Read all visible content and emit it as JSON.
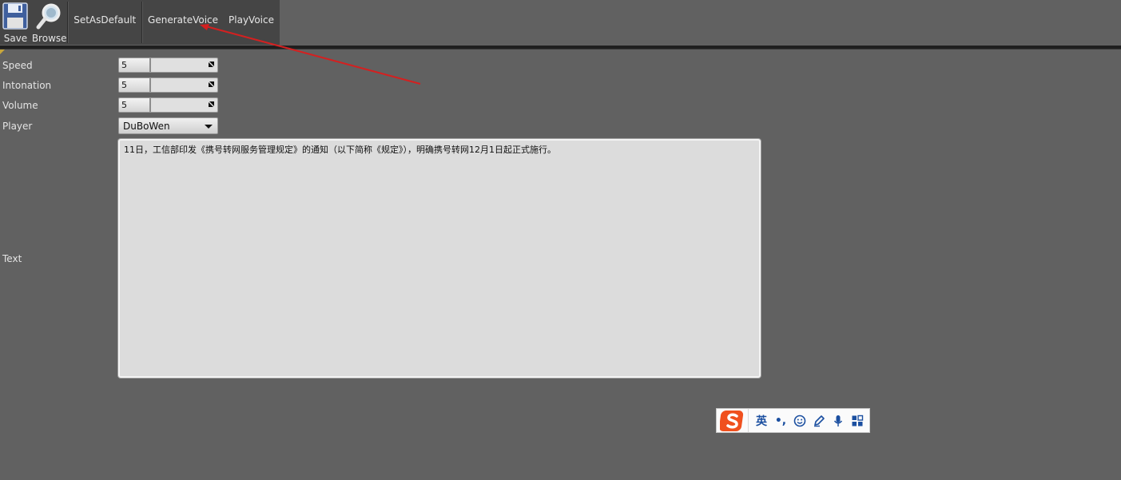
{
  "toolbar": {
    "save_label": "Save",
    "browse_label": "Browse",
    "set_as_default_label": "SetAsDefault",
    "generate_voice_label": "GenerateVoice",
    "play_voice_label": "PlayVoice"
  },
  "properties": {
    "speed": {
      "label": "Speed",
      "value": "5"
    },
    "intonation": {
      "label": "Intonation",
      "value": "5"
    },
    "volume": {
      "label": "Volume",
      "value": "5"
    },
    "player": {
      "label": "Player",
      "value": "DuBoWen"
    },
    "text": {
      "label": "Text",
      "value": "11日，工信部印发《携号转网服务管理规定》的通知（以下简称《规定》），明确携号转网12月1日起正式施行。"
    }
  },
  "ime": {
    "lang_label": "英",
    "punct_label": "•,",
    "icons": [
      "sogou-logo-icon",
      "emoji-icon",
      "handwriting-icon",
      "microphone-icon",
      "grid-menu-icon"
    ]
  },
  "colors": {
    "background": "#616161",
    "toolbar": "#454545",
    "annotation_arrow": "#d42020",
    "field_bg": "#e0e0e0",
    "sogou_orange": "#f0501e",
    "ime_blue": "#1b4fa0"
  }
}
